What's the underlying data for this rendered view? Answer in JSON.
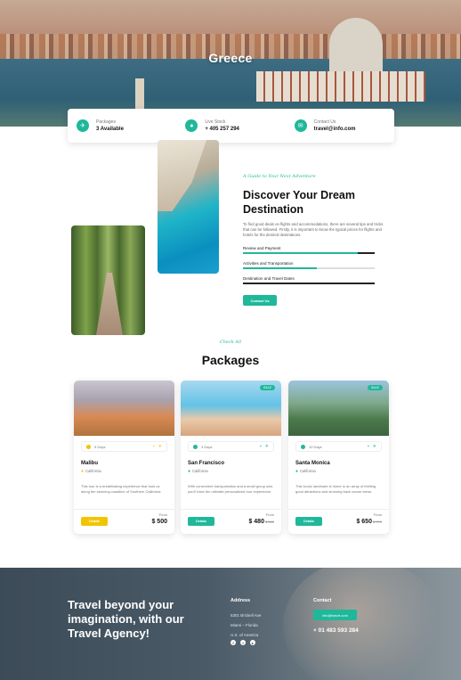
{
  "hero": {
    "title": "Greece"
  },
  "infobar": [
    {
      "icon": "plane-icon",
      "glyph": "✈",
      "label": "Packages",
      "value": "3 Available"
    },
    {
      "icon": "microphone-icon",
      "glyph": "●",
      "label": "Live Stock",
      "value": "+ 405 257 294"
    },
    {
      "icon": "mail-icon",
      "glyph": "✉",
      "label": "Contact Us",
      "value": "travel@info.com"
    }
  ],
  "intro": {
    "tagline": "A Guide to Your Next Adventure",
    "title": "Discover Your Dream Destination",
    "description": "To find good deals on flights and accommodations, there are several tips and tricks that can be followed. Firstly, it is important to know the typical prices for flights and hotels for the desired destinations.",
    "progress": [
      {
        "label": "Review and Payment",
        "percent": 87
      },
      {
        "label": "Activities and Transportation",
        "percent": 56
      },
      {
        "label": "Destination and Travel Dates",
        "percent": 100
      }
    ],
    "button": "Contact Us"
  },
  "packages": {
    "eyebrow": "Check All",
    "title": "Packages",
    "cards": [
      {
        "duration": "5 Days",
        "name": "Malibu",
        "location": "California",
        "description": "This tour is a breathtaking experience that took us along the stunning coastline of Southern California.",
        "button": "Details",
        "from": "From",
        "price": "$ 500",
        "old_price": "",
        "sale": "",
        "accent": "#f2c400"
      },
      {
        "duration": "3 Days",
        "name": "San Francisco",
        "location": "California",
        "description": "With convenient transportation and a small group size, you'll have the ultimate personalized tour experience.",
        "button": "Details",
        "from": "From",
        "price": "$ 480",
        "old_price": "$ 560",
        "sale": "SALE",
        "accent": "#1fb89a"
      },
      {
        "duration": "10 Days",
        "name": "Santa Monica",
        "location": "California",
        "description": "This iconic landmark is home to an array of thrilling good attractions and stunning back ocean views.",
        "button": "Details",
        "from": "From",
        "price": "$ 650",
        "old_price": "$ 770",
        "sale": "SALE",
        "accent": "#1fb89a"
      }
    ]
  },
  "footer": {
    "title": "Travel beyond your imagination, with our Travel Agency!",
    "address_heading": "Address",
    "address_lines": [
      "5301 Brickell Ave",
      "Miami – Florida",
      "U.S. of America"
    ],
    "contact_heading": "Contact",
    "email": "info@travel.com",
    "phone": "+ 01 483 593 284"
  }
}
